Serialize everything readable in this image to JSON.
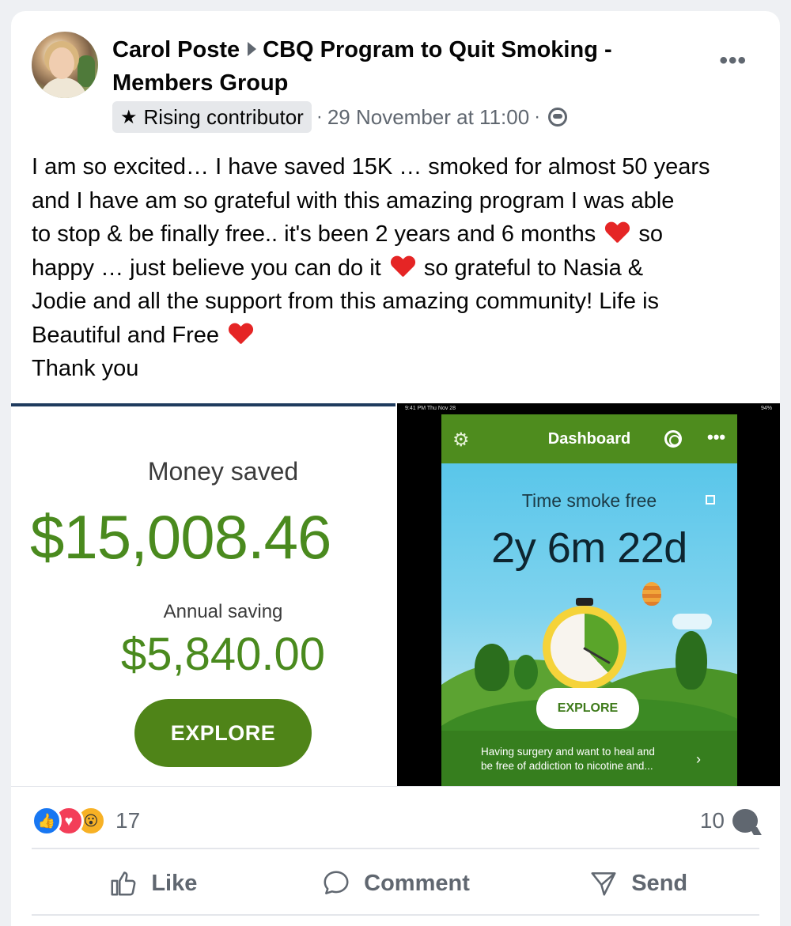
{
  "post": {
    "author": "Carol Poste",
    "group": "CBQ Program to Quit Smoking - Members Group",
    "badge": "Rising contributor",
    "timestamp": "29 November at 11:00",
    "more_label": "•••",
    "text_lines": [
      "I am so excited… I have saved 15K … smoked for almost 50 years",
      "and I have am so grateful with this amazing program I was able",
      "to stop & be finally free.. it's been 2 years and 6 months",
      "so",
      "happy … just believe you can do  it",
      "so grateful to Nasia &",
      "Jodie and all the support from this amazing community! Life is",
      "Beautiful and Free",
      "Thank you"
    ]
  },
  "media_left": {
    "money_label": "Money saved",
    "money_value": "$15,008.46",
    "annual_label": "Annual saving",
    "annual_value": "$5,840.00",
    "explore": "EXPLORE"
  },
  "media_right": {
    "status_left": "9:41 PM  Thu Nov 28",
    "status_right": "94%",
    "app_title": "Dashboard",
    "time_label": "Time smoke free",
    "time_value": "2y 6m 22d",
    "explore": "EXPLORE",
    "promo_line1": "Having surgery and want to heal and",
    "promo_line2": "be free of addiction to nicotine and...",
    "timer_fill_percent": 38
  },
  "footer": {
    "reaction_count": "17",
    "comment_count": "10",
    "like": "Like",
    "comment": "Comment",
    "send": "Send"
  },
  "colors": {
    "fb_blue": "#1877f2",
    "money_green": "#4a8a1e",
    "app_green": "#4e8c1e",
    "heart_red": "#e52525"
  }
}
